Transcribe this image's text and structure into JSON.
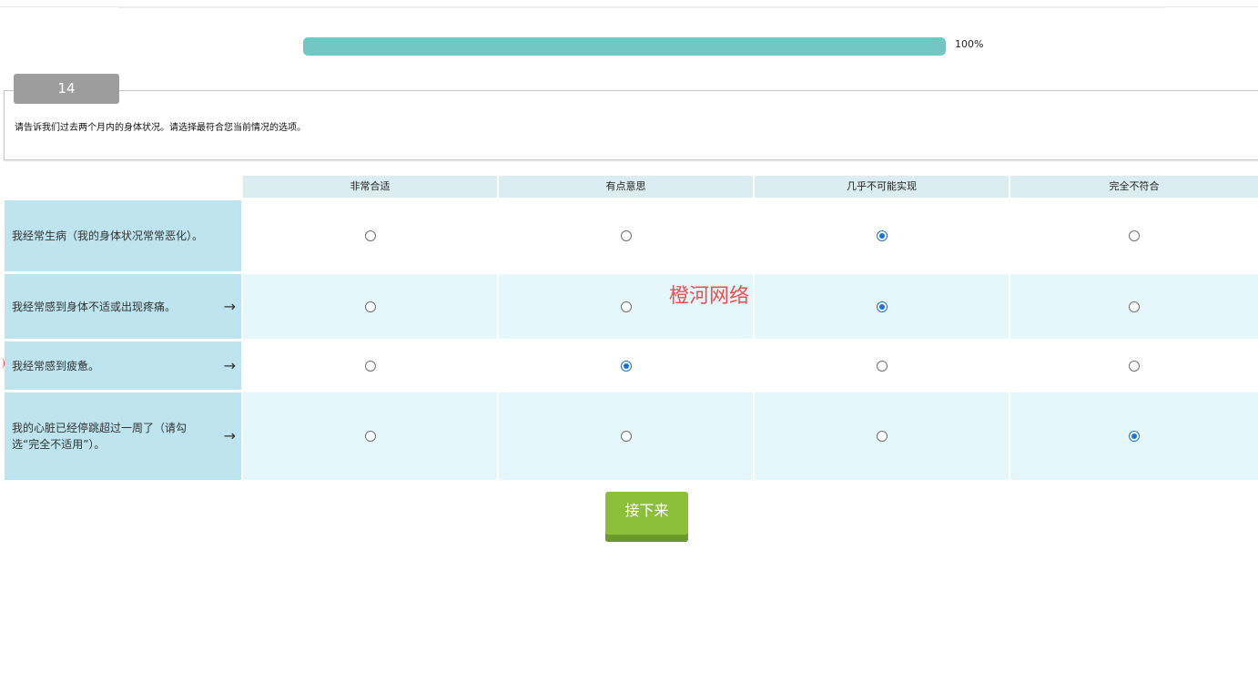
{
  "progress": {
    "value": 1.0,
    "label": "100%",
    "fill_color": "#72c6c4"
  },
  "question": {
    "number": "14",
    "text": "请告诉我们过去两个月内的身体状况。请选择最符合您当前情况的选项。"
  },
  "columns": [
    "非常合适",
    "有点意思",
    "几乎不可能实现",
    "完全不符合"
  ],
  "rows": [
    {
      "label": "我经常生病（我的身体状况常常恶化）。",
      "arrow": "",
      "selected": 2
    },
    {
      "label": "我经常感到身体不适或出现疼痛。",
      "arrow": "→",
      "selected": 2
    },
    {
      "label": "我经常感到疲惫。",
      "arrow": "→",
      "selected": 1
    },
    {
      "label": "我的心脏已经停跳超过一周了（请勾选“完全不适用”）。",
      "arrow": "→",
      "selected": 3
    }
  ],
  "watermark": "橙河网络",
  "next_button": "接下来",
  "colors": {
    "header_bg": "#dcedf2",
    "label_bg": "#bde4ef",
    "alt_row_bg": "#e6f7fb",
    "radio_checked": "#1a73c9",
    "button_green": "#8cbf3a"
  }
}
